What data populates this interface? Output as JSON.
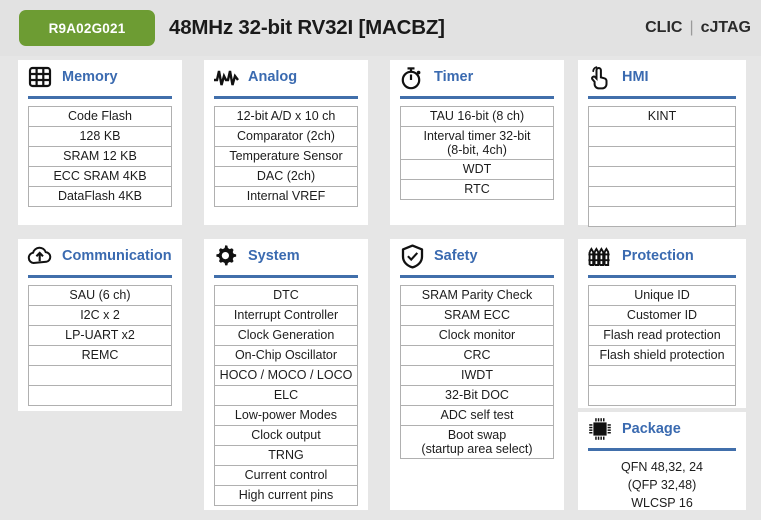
{
  "header": {
    "part_number": "R9A02G021",
    "title": "48MHz 32-bit RV32I [MACBZ]",
    "right_first": "CLIC",
    "right_divider": "|",
    "right_second": "cJTAG",
    "badge_color": "#6d9c33",
    "accent_color": "#416fab",
    "title_color": "#3a6ab0"
  },
  "cards": {
    "memory": {
      "title": "Memory",
      "icon": "grid-icon",
      "rows": [
        "Code Flash",
        "128 KB",
        "SRAM 12 KB",
        "ECC SRAM 4KB",
        "DataFlash 4KB"
      ]
    },
    "analog": {
      "title": "Analog",
      "icon": "waveform-icon",
      "rows": [
        "12-bit A/D x 10 ch",
        "Comparator (2ch)",
        "Temperature Sensor",
        "DAC (2ch)",
        "Internal VREF"
      ]
    },
    "timer": {
      "title": "Timer",
      "icon": "stopwatch-icon",
      "rows": [
        "TAU 16-bit (8 ch)",
        "Interval timer 32-bit\n(8-bit, 4ch)",
        "WDT",
        "RTC"
      ]
    },
    "hmi": {
      "title": "HMI",
      "icon": "touch-hand-icon",
      "rows": [
        "KINT",
        "",
        "",
        "",
        "",
        ""
      ]
    },
    "communication": {
      "title": "Communication",
      "icon": "cloud-upload-icon",
      "rows": [
        "SAU (6 ch)",
        "I2C x 2",
        "LP-UART x2",
        "REMC",
        "",
        ""
      ]
    },
    "system": {
      "title": "System",
      "icon": "gear-icon",
      "rows": [
        "DTC",
        "Interrupt Controller",
        "Clock Generation",
        "On-Chip Oscillator",
        "HOCO / MOCO / LOCO",
        "ELC",
        "Low-power Modes",
        "Clock output",
        "TRNG",
        "Current control",
        "High current pins"
      ]
    },
    "safety": {
      "title": "Safety",
      "icon": "shield-check-icon",
      "rows": [
        "SRAM Parity Check",
        "SRAM ECC",
        "Clock monitor",
        "CRC",
        "IWDT",
        "32-Bit DOC",
        "ADC self test",
        "Boot swap\n(startup area select)"
      ]
    },
    "protection": {
      "title": "Protection",
      "icon": "fence-icon",
      "rows": [
        "Unique ID",
        "Customer ID",
        "Flash read protection",
        "Flash shield protection",
        "",
        ""
      ]
    },
    "package": {
      "title": "Package",
      "icon": "chip-icon",
      "lines": [
        "QFN 48,32, 24",
        "(QFP 32,48)",
        "WLCSP 16"
      ]
    }
  }
}
